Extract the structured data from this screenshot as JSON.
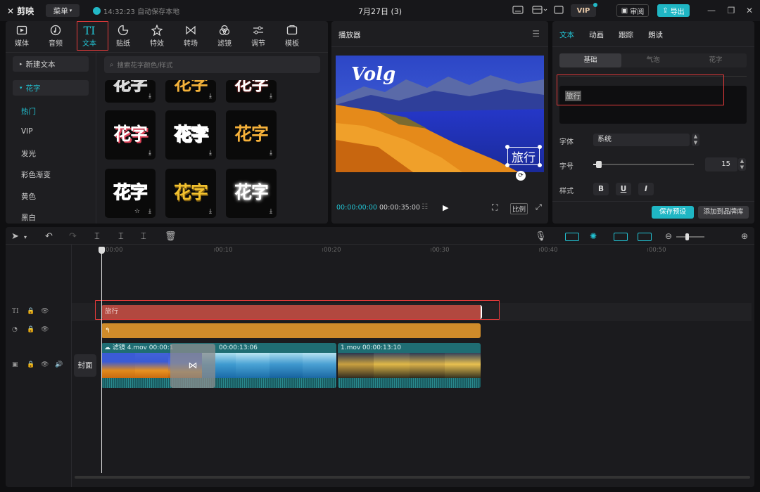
{
  "titlebar": {
    "app_name": "剪映",
    "menu_label": "菜单",
    "save_status": "14:32:23 自动保存本地",
    "project_title": "7月27日 (3)",
    "vip_label": "VIP",
    "review_label": "审阅",
    "export_label": "导出"
  },
  "media_tabs": [
    {
      "label": "媒体",
      "icon": "media-icon"
    },
    {
      "label": "音频",
      "icon": "audio-icon"
    },
    {
      "label": "文本",
      "icon": "text-icon",
      "active": true
    },
    {
      "label": "贴纸",
      "icon": "sticker-icon"
    },
    {
      "label": "特效",
      "icon": "effects-icon"
    },
    {
      "label": "转场",
      "icon": "transition-icon"
    },
    {
      "label": "滤镜",
      "icon": "filter-icon"
    },
    {
      "label": "调节",
      "icon": "adjust-icon"
    },
    {
      "label": "模板",
      "icon": "template-icon"
    }
  ],
  "sidebar": {
    "new_text": "新建文本",
    "category": "花字",
    "items": [
      "热门",
      "VIP",
      "发光",
      "彩色渐变",
      "黄色",
      "黑白"
    ]
  },
  "search": {
    "placeholder": "搜索花字颜色/样式"
  },
  "tiles": {
    "text": "花字"
  },
  "player": {
    "title": "播放器",
    "overlay_logo": "Volg",
    "overlay_text": "旅行",
    "time_current": "00:00:00:00",
    "time_total": "00:00:35:00",
    "ratio_label": "比例"
  },
  "props": {
    "tabs": [
      "文本",
      "动画",
      "跟踪",
      "朗读"
    ],
    "subtabs": [
      "基础",
      "气泡",
      "花字"
    ],
    "text_value": "旅行",
    "font_label": "字体",
    "font_value": "系统",
    "size_label": "字号",
    "size_value": "15",
    "size_slider_fraction": 0.05,
    "style_label": "样式",
    "style_buttons": [
      "B",
      "U",
      "I"
    ],
    "save_preset": "保存预设",
    "add_brand": "添加到品牌库"
  },
  "timeline": {
    "ruler": [
      "00:00",
      "00:10",
      "00:20",
      "00:30",
      "00:40",
      "00:50"
    ],
    "cover_label": "封面",
    "text_clip": "旅行",
    "video_clip1": "滤镜   4.mov   00:00:1",
    "video_clip1_dur": "00:00:13:06",
    "video_clip2": "1.mov   00:00:13:10"
  },
  "colors": {
    "accent": "#22c3d3",
    "highlight": "#e63b3b",
    "text_clip": "#b2483f",
    "effect_clip": "#cf8b2a",
    "video_clip": "#1f6d73"
  }
}
